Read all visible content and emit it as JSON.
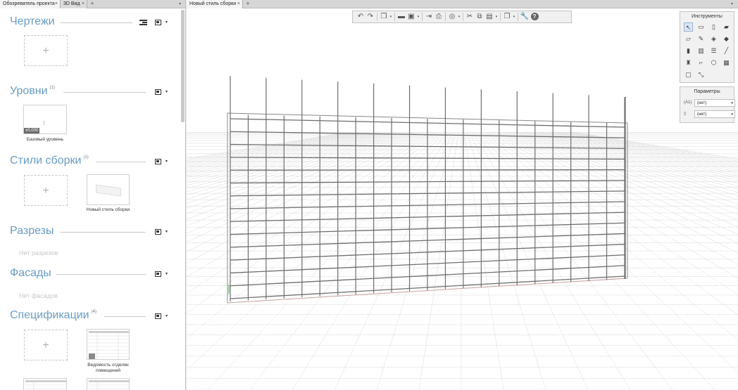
{
  "left_tabs": [
    {
      "label": "Обозреватель проекта",
      "active": true
    },
    {
      "label": "3D Вид",
      "active": false
    }
  ],
  "right_tabs": [
    {
      "label": "Новый стиль сборки",
      "active": true
    }
  ],
  "tab_close": "×",
  "tab_add": "+",
  "tab_menu": "▾",
  "sections": {
    "drawings": {
      "title": "Чертежи",
      "count": ""
    },
    "levels": {
      "title": "Уровни",
      "count": "(1)",
      "item_label": "Базовый уровень",
      "level_value": "±0,000"
    },
    "assembly_styles": {
      "title": "Стили сборки",
      "count": "(1)",
      "item_label": "Новый стиль сборки"
    },
    "sections": {
      "title": "Разрезы",
      "count": "",
      "empty": "Нет разрезов"
    },
    "facades": {
      "title": "Фасады",
      "count": "",
      "empty": "Нет фасадов"
    },
    "specifications": {
      "title": "Спецификации",
      "count": "(4)",
      "item_label_1": "Ведомость отделки",
      "item_label_2": "помещений"
    }
  },
  "add_symbol": "+",
  "dropdown_arrow": "▾",
  "tools_panel": {
    "title": "Инструменты"
  },
  "params_panel": {
    "title": "Параметры",
    "rows": [
      {
        "icon": "(A1)",
        "value": "(нет)"
      },
      {
        "icon": "▯",
        "value": "(нет)"
      }
    ]
  },
  "colors": {
    "accent_title": "#6a9cc4",
    "grid_line": "#dadada",
    "rebar": "#6e6e6e"
  }
}
